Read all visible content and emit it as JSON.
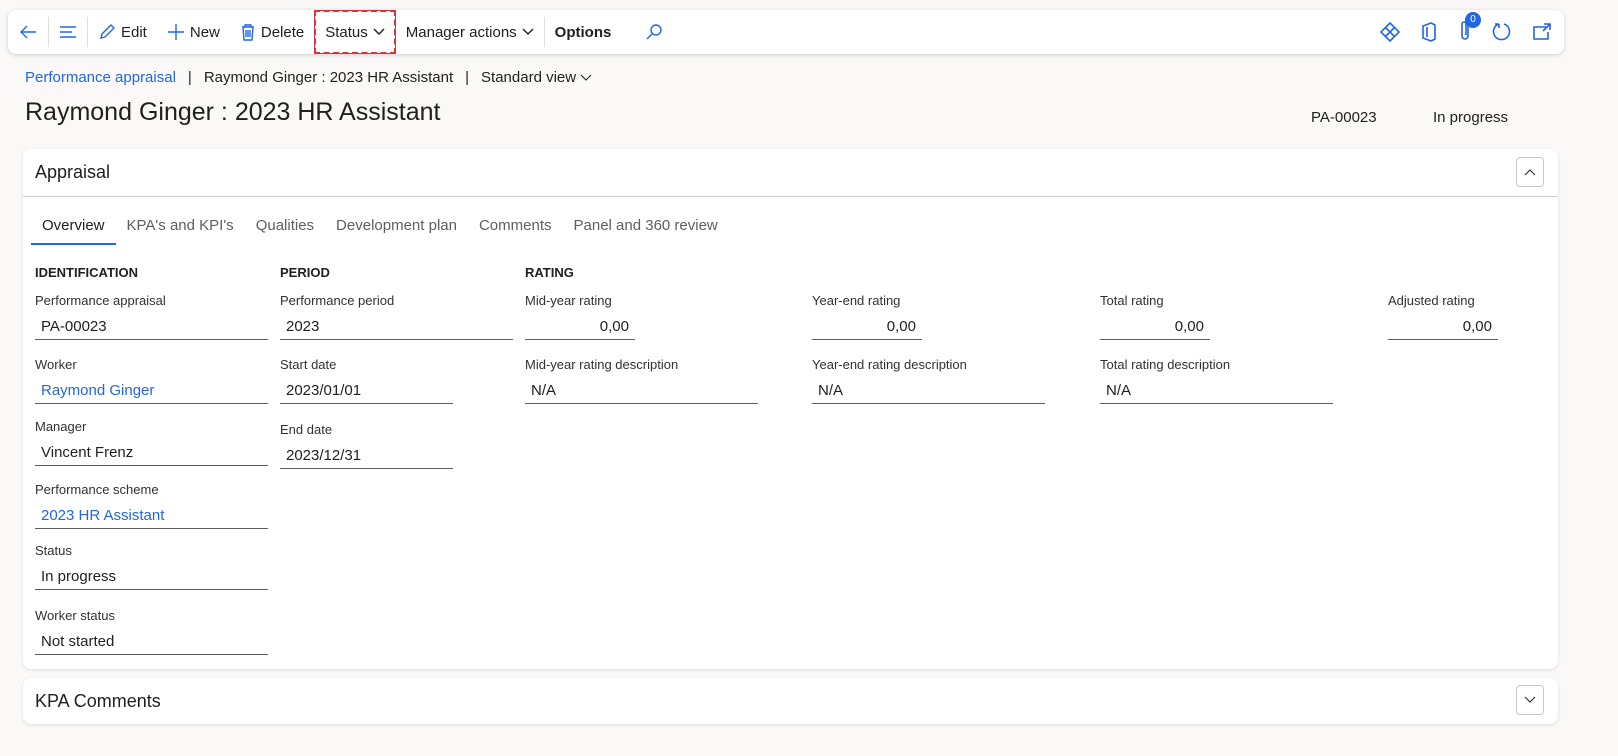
{
  "toolbar": {
    "edit": "Edit",
    "new": "New",
    "delete": "Delete",
    "status": "Status",
    "manager_actions": "Manager actions",
    "options": "Options",
    "attachments_count": "0"
  },
  "breadcrumb": {
    "module": "Performance appraisal",
    "record": "Raymond Ginger : 2023 HR Assistant",
    "view": "Standard view"
  },
  "header": {
    "title": "Raymond Ginger : 2023 HR Assistant",
    "id": "PA-00023",
    "status": "In progress"
  },
  "appraisal": {
    "title": "Appraisal",
    "tabs": [
      "Overview",
      "KPA's and KPI's",
      "Qualities",
      "Development plan",
      "Comments",
      "Panel and 360 review"
    ],
    "identification": {
      "heading": "IDENTIFICATION",
      "fields": [
        {
          "label": "Performance appraisal",
          "value": "PA-00023"
        },
        {
          "label": "Worker",
          "value": "Raymond Ginger"
        },
        {
          "label": "Manager",
          "value": "Vincent Frenz"
        },
        {
          "label": "Performance scheme",
          "value": "2023 HR Assistant"
        },
        {
          "label": "Status",
          "value": "In progress"
        },
        {
          "label": "Worker status",
          "value": "Not started"
        }
      ]
    },
    "period": {
      "heading": "PERIOD",
      "fields": [
        {
          "label": "Performance period",
          "value": "2023"
        },
        {
          "label": "Start date",
          "value": "2023/01/01"
        },
        {
          "label": "End date",
          "value": "2023/12/31"
        }
      ]
    },
    "rating": {
      "heading": "RATING",
      "fields": [
        {
          "label": "Mid-year rating",
          "value": "0,00"
        },
        {
          "label": "Year-end rating",
          "value": "0,00"
        },
        {
          "label": "Total rating",
          "value": "0,00"
        },
        {
          "label": "Adjusted rating",
          "value": "0,00"
        },
        {
          "label": "Mid-year rating description",
          "value": "N/A"
        },
        {
          "label": "Year-end rating description",
          "value": "N/A"
        },
        {
          "label": "Total rating description",
          "value": "N/A"
        }
      ]
    }
  },
  "kpa_comments": {
    "title": "KPA Comments"
  }
}
